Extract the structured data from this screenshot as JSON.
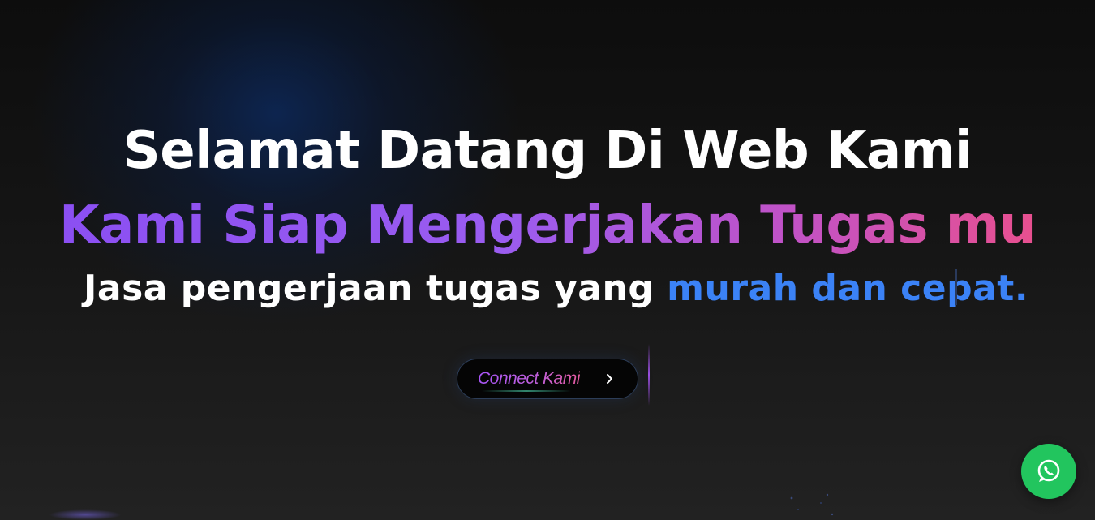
{
  "hero": {
    "headline": "Selamat Datang Di Web Kami",
    "subheadline": "Kami Siap Mengerjakan Tugas mu",
    "tagline_prefix": "Jasa pengerjaan tugas yang ",
    "tagline_highlight": "murah dan cepat.",
    "cta_label": "Connect Kami"
  },
  "icons": {
    "cta_icon": "chevron-right-icon",
    "floating_button_icon": "whatsapp-icon"
  },
  "colors": {
    "background": "#161616",
    "headline": "#ffffff",
    "subheadline_gradient_start": "#8b4ff2",
    "subheadline_gradient_end": "#e8508f",
    "tagline_highlight": "#3b82f6",
    "whatsapp_button": "#22c55e"
  }
}
